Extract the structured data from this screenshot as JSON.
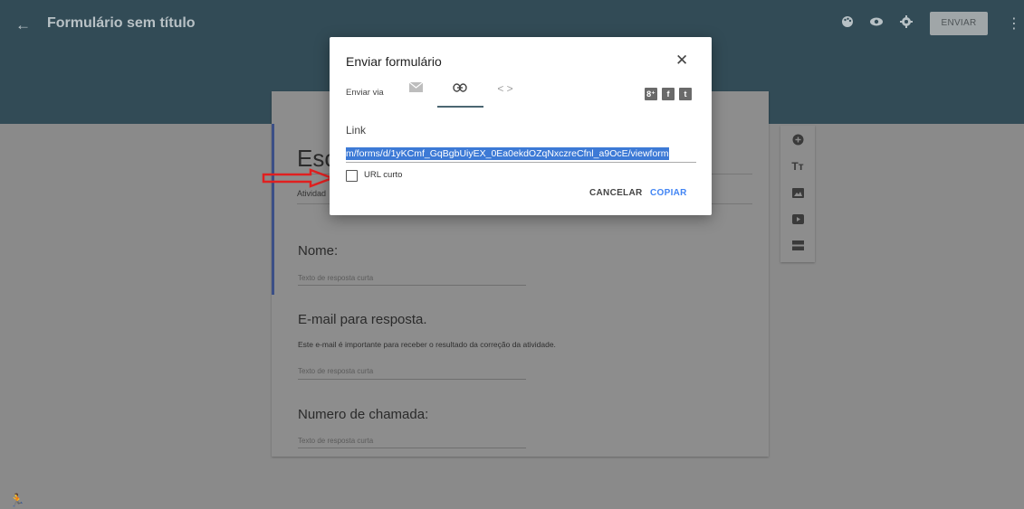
{
  "appbar": {
    "back_icon": "arrow-back-icon",
    "title": "Formulário sem título",
    "tools": [
      "palette-icon",
      "eye-icon",
      "gear-icon"
    ],
    "send_label": "ENVIAR",
    "menu_icon": "more-vert-icon"
  },
  "form": {
    "title": "Esc",
    "description": "Atividad",
    "questions": [
      {
        "title": "Nome:",
        "help": "",
        "placeholder": "Texto de resposta curta"
      },
      {
        "title": "E-mail para resposta.",
        "help": "Este e-mail é importante para receber o resultado da correção da atividade.",
        "placeholder": "Texto de resposta curta"
      },
      {
        "title": "Numero de chamada:",
        "help": "",
        "placeholder": "Texto de resposta curta"
      }
    ]
  },
  "side_toolbar": [
    "add-circle-icon",
    "title-icon",
    "image-icon",
    "video-icon",
    "section-icon"
  ],
  "dialog": {
    "title": "Enviar formulário",
    "close_icon": "close-icon",
    "via_label": "Enviar via",
    "tabs": [
      {
        "icon": "email-icon",
        "glyph": "✉"
      },
      {
        "icon": "link-icon",
        "glyph": "⊖"
      },
      {
        "icon": "embed-icon",
        "glyph": "< >"
      }
    ],
    "social": {
      "gplus": "8⁺",
      "facebook": "f",
      "twitter": "t"
    },
    "link_label": "Link",
    "link_value": "m/forms/d/1yKCmf_GqBgbUiyEX_0Ea0ekdOZqNxczreCfnl_a9OcE/viewform",
    "short_url_label": "URL curto",
    "cancel_label": "CANCELAR",
    "copy_label": "COPIAR"
  },
  "colors": {
    "accent": "#3b4f86",
    "primary_button": "#4285f4",
    "appbar": "#324b56",
    "annotation_arrow": "#e02020"
  }
}
